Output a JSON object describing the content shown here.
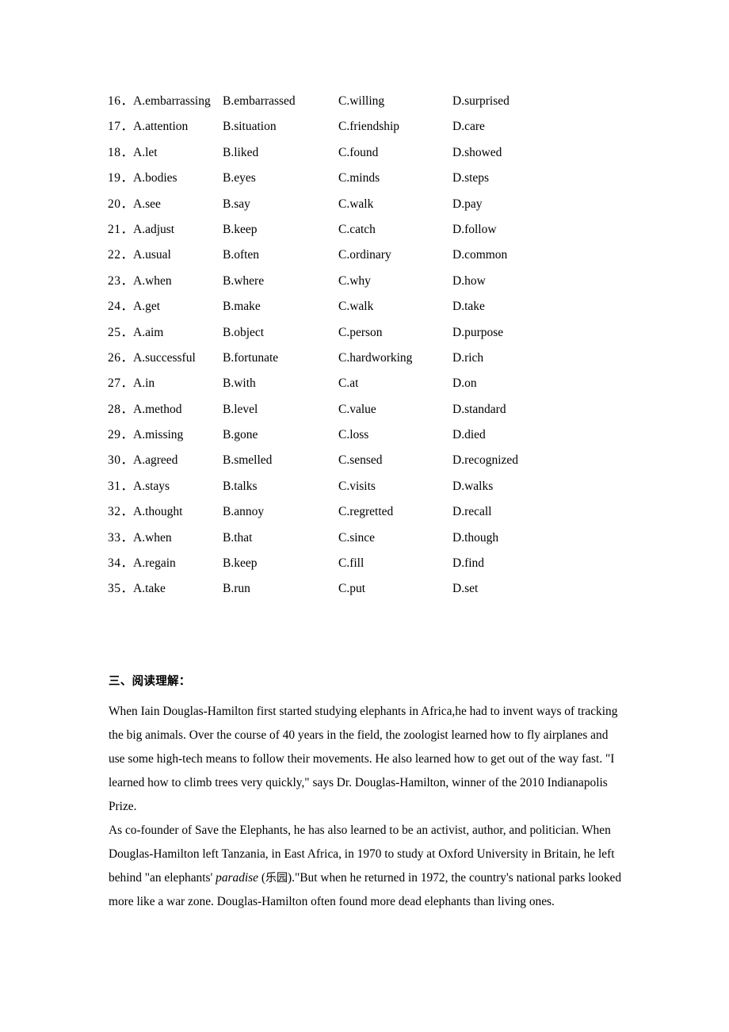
{
  "document": {
    "page_background": "#ffffff",
    "text_color": "#000000"
  },
  "cloze": {
    "rows": [
      {
        "num": "16．",
        "a": "A.embarrassing",
        "b": "B.embarrassed",
        "c": "C.willing",
        "d": "D.surprised"
      },
      {
        "num": "17．",
        "a": "A.attention",
        "b": "B.situation",
        "c": "C.friendship",
        "d": "D.care"
      },
      {
        "num": "18．",
        "a": "A.let",
        "b": "B.liked",
        "c": "C.found",
        "d": "D.showed"
      },
      {
        "num": "19．",
        "a": "A.bodies",
        "b": "B.eyes",
        "c": "C.minds",
        "d": "D.steps"
      },
      {
        "num": "20．",
        "a": "A.see",
        "b": "B.say",
        "c": "C.walk",
        "d": "D.pay"
      },
      {
        "num": "21．",
        "a": "A.adjust",
        "b": "B.keep",
        "c": "C.catch",
        "d": "D.follow"
      },
      {
        "num": "22．",
        "a": "A.usual",
        "b": "B.often",
        "c": "C.ordinary",
        "d": "D.common"
      },
      {
        "num": "23．",
        "a": "A.when",
        "b": "B.where",
        "c": "C.why",
        "d": "D.how"
      },
      {
        "num": "24．",
        "a": "A.get",
        "b": "B.make",
        "c": "C.walk",
        "d": "D.take"
      },
      {
        "num": "25．",
        "a": "A.aim",
        "b": "B.object",
        "c": "C.person",
        "d": "D.purpose"
      },
      {
        "num": "26．",
        "a": "A.successful",
        "b": "B.fortunate",
        "c": "C.hardworking",
        "d": "D.rich"
      },
      {
        "num": "27．",
        "a": "A.in",
        "b": "B.with",
        "c": "C.at",
        "d": "D.on"
      },
      {
        "num": "28．",
        "a": "A.method",
        "b": "B.level",
        "c": "C.value",
        "d": "D.standard"
      },
      {
        "num": "29．",
        "a": "A.missing",
        "b": "B.gone",
        "c": "C.loss",
        "d": "D.died"
      },
      {
        "num": "30．",
        "a": "A.agreed",
        "b": "B.smelled",
        "c": "C.sensed",
        "d": "D.recognized"
      },
      {
        "num": "31．",
        "a": "A.stays",
        "b": "B.talks",
        "c": "C.visits",
        "d": "D.walks"
      },
      {
        "num": "32．",
        "a": "A.thought",
        "b": "B.annoy",
        "c": "C.regretted",
        "d": "D.recall"
      },
      {
        "num": "33．",
        "a": "A.when",
        "b": "B.that",
        "c": "C.since",
        "d": "D.though"
      },
      {
        "num": "34．",
        "a": "A.regain",
        "b": "B.keep",
        "c": "C.fill",
        "d": "D.find"
      },
      {
        "num": "35．",
        "a": "A.take",
        "b": "B.run",
        "c": "C.put",
        "d": "D.set"
      }
    ]
  },
  "reading": {
    "heading": "三、阅读理解：",
    "paragraph1": "When Iain Douglas-Hamilton first started studying elephants in Africa,he had to invent ways of tracking the big animals. Over the course of 40 years in the field, the zoologist learned how to fly airplanes and use some high-tech means to follow their movements. He also learned how to get out of the way fast. \"I learned how to climb trees very quickly,\" says Dr. Douglas-Hamilton, winner of the 2010 Indianapolis Prize.",
    "paragraph2_part1": "As co-founder of Save the Elephants, he has also learned to be an activist, author, and politician. When Douglas-Hamilton left Tanzania, in East Africa, in 1970 to study at Oxford University in Britain, he left behind \"an elephants' ",
    "paragraph2_italic": "paradise",
    "paragraph2_gloss_open": " (",
    "paragraph2_gloss": "乐园",
    "paragraph2_part2": ").\"But when he returned in 1972, the country's national parks looked more like a war zone. Douglas-Hamilton often found more dead elephants than living ones."
  }
}
